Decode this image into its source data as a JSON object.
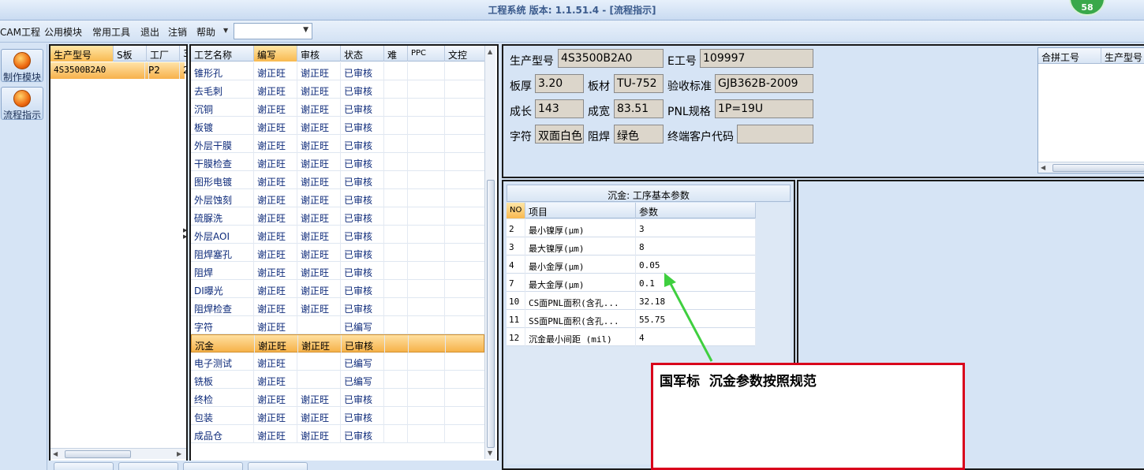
{
  "window": {
    "title": "工程系统   版本: 1.1.51.4 - [流程指示]",
    "badge": "58"
  },
  "menu": {
    "items": [
      "CAM工程",
      "公用模块",
      "常用工具",
      "退出",
      "注销",
      "帮助"
    ],
    "combo_value": ""
  },
  "nav": {
    "items": [
      {
        "label": "制作模块"
      },
      {
        "label": "流程指示"
      }
    ]
  },
  "production": {
    "headers": [
      "生产型号",
      "S板",
      "工厂",
      "3"
    ],
    "row": [
      "4S3500B2A0",
      "",
      "P2",
      "2"
    ]
  },
  "process": {
    "headers": [
      "工艺名称",
      "编写",
      "审核",
      "状态",
      "难",
      "PPC",
      "文控"
    ],
    "rows": [
      [
        "锥形孔",
        "谢正旺",
        "谢正旺",
        "已审核"
      ],
      [
        "去毛刺",
        "谢正旺",
        "谢正旺",
        "已审核"
      ],
      [
        "沉铜",
        "谢正旺",
        "谢正旺",
        "已审核"
      ],
      [
        "板镀",
        "谢正旺",
        "谢正旺",
        "已审核"
      ],
      [
        "外层干膜",
        "谢正旺",
        "谢正旺",
        "已审核"
      ],
      [
        "干膜检查",
        "谢正旺",
        "谢正旺",
        "已审核"
      ],
      [
        "图形电镀",
        "谢正旺",
        "谢正旺",
        "已审核"
      ],
      [
        "外层蚀刻",
        "谢正旺",
        "谢正旺",
        "已审核"
      ],
      [
        "硫脲洗",
        "谢正旺",
        "谢正旺",
        "已审核"
      ],
      [
        "外层AOI",
        "谢正旺",
        "谢正旺",
        "已审核"
      ],
      [
        "阻焊塞孔",
        "谢正旺",
        "谢正旺",
        "已审核"
      ],
      [
        "阻焊",
        "谢正旺",
        "谢正旺",
        "已审核"
      ],
      [
        "DI曝光",
        "谢正旺",
        "谢正旺",
        "已审核"
      ],
      [
        "阻焊检查",
        "谢正旺",
        "谢正旺",
        "已审核"
      ],
      [
        "字符",
        "谢正旺",
        "",
        "已编写"
      ],
      [
        "沉金",
        "谢正旺",
        "谢正旺",
        "已审核"
      ],
      [
        "电子测试",
        "谢正旺",
        "",
        "已编写"
      ],
      [
        "铣板",
        "谢正旺",
        "",
        "已编写"
      ],
      [
        "终检",
        "谢正旺",
        "谢正旺",
        "已审核"
      ],
      [
        "包装",
        "谢正旺",
        "谢正旺",
        "已审核"
      ],
      [
        "成品仓",
        "谢正旺",
        "谢正旺",
        "已审核"
      ]
    ],
    "selected_index": 15
  },
  "info": {
    "model_label": "生产型号",
    "model": "4S3500B2A0",
    "eno_label": "E工号",
    "eno": "109997",
    "thick_label": "板厚",
    "thick": "3.20",
    "material_label": "板材",
    "material": "TU-752",
    "std_label": "验收标准",
    "std": "GJB362B-2009",
    "len_label": "成长",
    "len": "143",
    "wid_label": "成宽",
    "wid": "83.51",
    "pnl_label": "PNL规格",
    "pnl": "1P=19U",
    "char_label": "字符",
    "char": "双面白色",
    "mask_label": "阻焊",
    "mask": "绿色",
    "cust_label": "终端客户代码",
    "cust": ""
  },
  "merge": {
    "headers": [
      "合拼工号",
      "生产型号"
    ]
  },
  "params": {
    "title": "沉金: 工序基本参数",
    "headers": [
      "NO",
      "项目",
      "参数"
    ],
    "rows": [
      [
        "2",
        "最小镍厚(μm)",
        "3"
      ],
      [
        "3",
        "最大镍厚(μm)",
        "8"
      ],
      [
        "4",
        "最小金厚(μm)",
        "0.05"
      ],
      [
        "7",
        "最大金厚(μm)",
        "0.1"
      ],
      [
        "10",
        "CS面PNL面积(含孔...",
        "32.18"
      ],
      [
        "11",
        "SS面PNL面积(含孔...",
        "55.75"
      ],
      [
        "12",
        "沉金最小间距 (mil)",
        "4"
      ]
    ]
  },
  "annotation": {
    "text": "国军标  沉金参数按照规范",
    "arrow_color": "#3fcf3f",
    "box_color": "#d9001b"
  }
}
